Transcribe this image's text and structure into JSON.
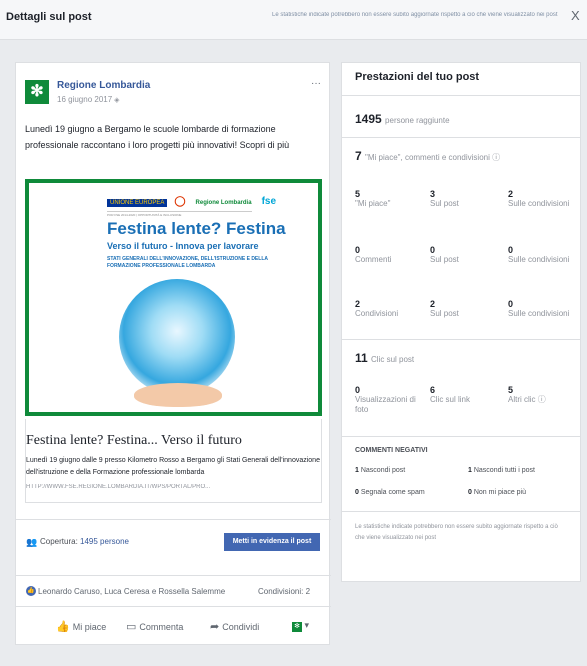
{
  "topbar": {
    "title": "Dettagli sul post",
    "notice": "Le statistiche indicate potrebbero non essere subito aggiornate rispetto a ciò che viene visualizzato nei post",
    "close": "X"
  },
  "post": {
    "page_name": "Regione Lombardia",
    "date": "16 giugno 2017",
    "privacy_icon": "globe-icon",
    "more": "···",
    "text": "Lunedì 19 giugno a Bergamo le scuole lombarde di formazione professionale raccontano i loro progetti più innovativi! Scopri di più",
    "image": {
      "logos": [
        "UNIONE EUROPEA",
        "Regione Lombardia",
        "fse"
      ],
      "tagline": "POR FSE 2014-2020 | OPPORTUNITÀ E INCLUSIONE",
      "title": "Festina lente? Festina",
      "subtitle": "Verso il futuro - Innova per lavorare",
      "stati": "STATI GENERALI DELL'INNOVAZIONE, DELL'ISTRUZIONE E DELLA FORMAZIONE PROFESSIONALE LOMBARDA"
    },
    "link_title": "Festina lente? Festina... Verso il futuro",
    "link_desc": "Lunedì 19 giugno dalle 9 presso Kilometro Rosso a Bergamo gli Stati Generali dell'innovazione dell'istruzione e della Formazione professionale lombarda",
    "link_url": "HTTP://WWW.FSE.REGIONE.LOMBARDIA.IT/WPS/PORTAL/PRO...",
    "coverage_label": "Copertura:",
    "coverage_value": "1495 persone",
    "boost_label": "Metti in evidenza il post",
    "likers": "Leonardo Caruso, Luca Ceresa e Rossella Salemme",
    "shares": "Condivisioni: 2",
    "actions": {
      "like": "Mi piace",
      "comment": "Commenta",
      "share": "Condividi"
    }
  },
  "stats": {
    "heading": "Prestazioni del tuo post",
    "reach_value": "1495",
    "reach_label": "persone raggiunte",
    "interactions_value": "7",
    "interactions_label": "\"Mi piace\", commenti e condivisioni",
    "grid": [
      [
        {
          "n": "5",
          "label": "\"Mi piace\""
        },
        {
          "n": "3",
          "label": "Sul post"
        },
        {
          "n": "2",
          "label": "Sulle condivisioni"
        }
      ],
      [
        {
          "n": "0",
          "label": "Commenti"
        },
        {
          "n": "0",
          "label": "Sul post"
        },
        {
          "n": "0",
          "label": "Sulle condivisioni"
        }
      ],
      [
        {
          "n": "2",
          "label": "Condivisioni"
        },
        {
          "n": "2",
          "label": "Sul post"
        },
        {
          "n": "0",
          "label": "Sulle condivisioni"
        }
      ]
    ],
    "clicks_value": "11",
    "clicks_label": "Clic sul post",
    "clicks": [
      {
        "n": "0",
        "label": "Visualizzazioni di foto"
      },
      {
        "n": "6",
        "label": "Clic sul link"
      },
      {
        "n": "5",
        "label": "Altri clic"
      }
    ],
    "negative_heading": "COMMENTI NEGATIVI",
    "negative": [
      {
        "n": "1",
        "label": "Nascondi post"
      },
      {
        "n": "1",
        "label": "Nascondi tutti i post"
      },
      {
        "n": "0",
        "label": "Segnala come spam"
      },
      {
        "n": "0",
        "label": "Non mi piace più"
      }
    ],
    "footer": "Le statistiche indicate potrebbero non essere subito aggiornate rispetto a ciò che viene visualizzato nei post"
  }
}
